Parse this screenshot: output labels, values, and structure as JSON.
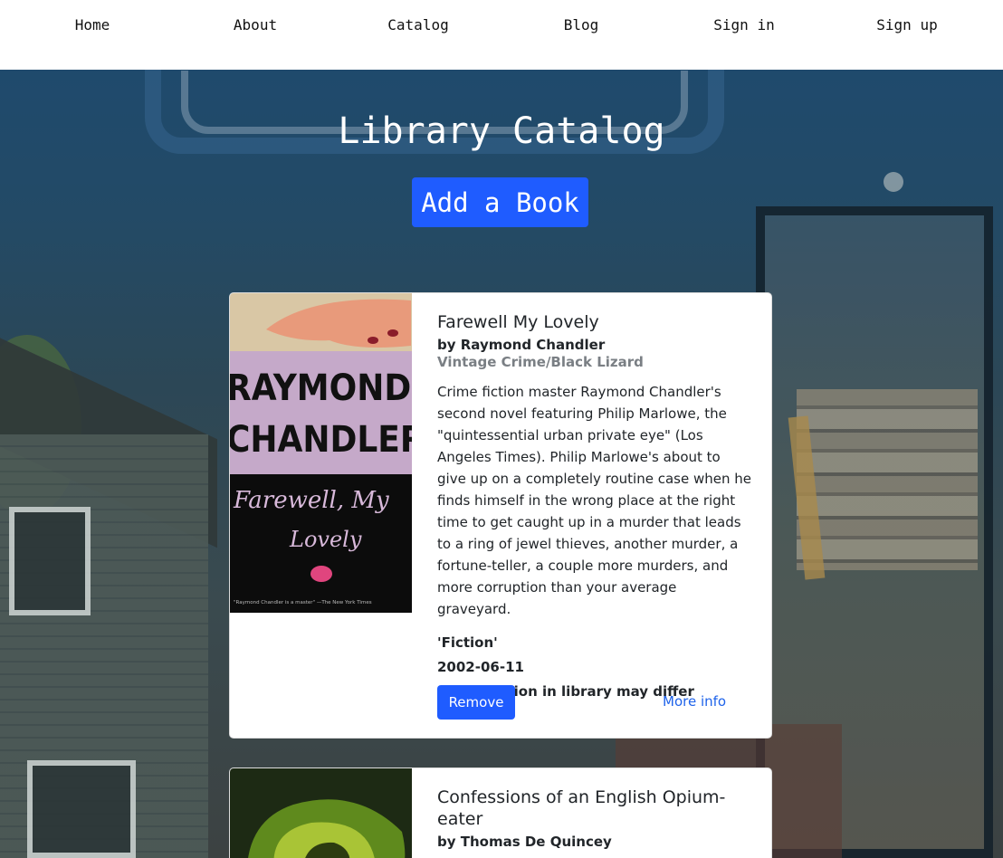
{
  "nav": {
    "items": [
      {
        "label": "Home"
      },
      {
        "label": "About"
      },
      {
        "label": "Catalog"
      },
      {
        "label": "Blog"
      },
      {
        "label": "Sign in"
      },
      {
        "label": "Sign up"
      }
    ]
  },
  "page": {
    "title": "Library Catalog",
    "add_button": "Add a Book"
  },
  "books": [
    {
      "title": "Farewell My Lovely",
      "author": "by Raymond Chandler",
      "publisher": "Vintage Crime/Black Lizard",
      "description": "Crime fiction master Raymond Chandler's second novel featuring Philip Marlowe, the \"quintessential urban private eye\" (Los Angeles Times). Philip Marlowe's about to give up on a completely routine case when he finds himself in the wrong place at the right time to get caught up in a murder that leads to a ring of jewel thieves, another murder, a fortune-teller, a couple more murders, and more corruption than your average graveyard.",
      "genre": "'Fiction'",
      "date": "2002-06-11",
      "note": "Note: edition in library may differ",
      "remove_label": "Remove",
      "more_label": "More info",
      "cover": {
        "top_text_1": "RAYMOND",
        "top_text_2": "CHANDLER",
        "script_1": "Farewell, My",
        "script_2": "Lovely",
        "tiny": "\"Raymond Chandler is a master\" —The New York Times"
      }
    },
    {
      "title": "Confessions of an English Opium-eater",
      "author": "by Thomas De Quincey"
    }
  ],
  "colors": {
    "accent": "#1f5cff",
    "link": "#1f63ea",
    "nav_bg": "#ffffff"
  }
}
